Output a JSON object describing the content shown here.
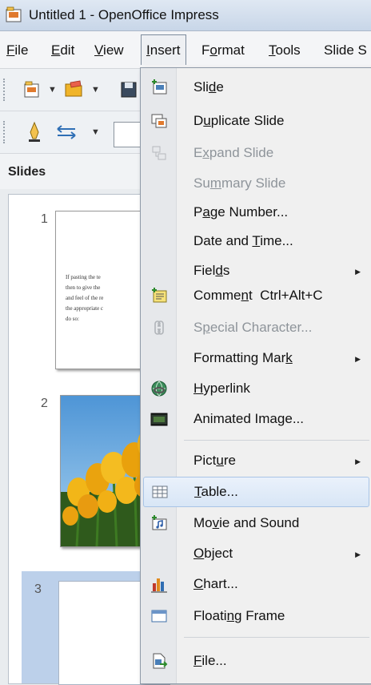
{
  "window": {
    "title": "Untitled 1 - OpenOffice Impress"
  },
  "menubar": {
    "items": [
      {
        "id": "file",
        "pre": "",
        "ul": "F",
        "post": "ile"
      },
      {
        "id": "edit",
        "pre": "",
        "ul": "E",
        "post": "dit"
      },
      {
        "id": "view",
        "pre": "",
        "ul": "V",
        "post": "iew"
      },
      {
        "id": "insert",
        "pre": "",
        "ul": "I",
        "post": "nsert"
      },
      {
        "id": "format",
        "pre": "F",
        "ul": "o",
        "post": "rmat"
      },
      {
        "id": "tools",
        "pre": "",
        "ul": "T",
        "post": "ools"
      },
      {
        "id": "slideshow",
        "pre": "Slide S",
        "ul": "",
        "post": ""
      }
    ]
  },
  "slides_pane": {
    "title": "Slides",
    "slides": [
      {
        "number": "1",
        "text": "If pasting the te\nthen to give the\nand feel of the re\nthe appropriate c\ndo so:"
      },
      {
        "number": "2"
      },
      {
        "number": "3"
      }
    ]
  },
  "insert_menu": {
    "items": [
      {
        "pre": "Sli",
        "ul": "d",
        "post": "e",
        "icon": "slide-icon",
        "enabled": true
      },
      {
        "pre": "D",
        "ul": "u",
        "post": "plicate Slide",
        "icon": "duplicate-slide-icon",
        "enabled": true
      },
      {
        "pre": "E",
        "ul": "x",
        "post": "pand Slide",
        "icon": "expand-slide-icon",
        "enabled": false
      },
      {
        "pre": "Su",
        "ul": "m",
        "post": "mary Slide",
        "icon": "",
        "enabled": false
      },
      {
        "pre": "P",
        "ul": "a",
        "post": "ge Number...",
        "icon": "",
        "enabled": true
      },
      {
        "pre": "Date and ",
        "ul": "T",
        "post": "ime...",
        "icon": "",
        "enabled": true
      },
      {
        "pre": "Fiel",
        "ul": "d",
        "post": "s",
        "icon": "",
        "enabled": true,
        "submenu": true
      },
      {
        "pre": "Comme",
        "ul": "n",
        "post": "t",
        "shortcut": "Ctrl+Alt+C",
        "icon": "comment-icon",
        "enabled": true
      },
      {
        "pre": "S",
        "ul": "p",
        "post": "ecial Character...",
        "icon": "special-character-icon",
        "enabled": false
      },
      {
        "pre": "Formatting Mar",
        "ul": "k",
        "post": "",
        "icon": "",
        "enabled": true,
        "submenu": true
      },
      {
        "pre": "",
        "ul": "H",
        "post": "yperlink",
        "icon": "hyperlink-icon",
        "enabled": true
      },
      {
        "pre": "Animated Ima",
        "ul": "g",
        "post": "e...",
        "icon": "animated-image-icon",
        "enabled": true
      },
      {
        "pre": "Pict",
        "ul": "u",
        "post": "re",
        "icon": "",
        "enabled": true,
        "submenu": true
      },
      {
        "pre": "",
        "ul": "T",
        "post": "able...",
        "icon": "table-icon",
        "enabled": true,
        "highlighted": true
      },
      {
        "pre": "Mo",
        "ul": "v",
        "post": "ie and Sound",
        "icon": "movie-sound-icon",
        "enabled": true
      },
      {
        "pre": "",
        "ul": "O",
        "post": "bject",
        "icon": "",
        "enabled": true,
        "submenu": true
      },
      {
        "pre": "",
        "ul": "C",
        "post": "hart...",
        "icon": "chart-icon",
        "enabled": true
      },
      {
        "pre": "Floati",
        "ul": "n",
        "post": "g Frame",
        "icon": "floating-frame-icon",
        "enabled": true
      },
      {
        "pre": "",
        "ul": "F",
        "post": "ile...",
        "icon": "file-icon",
        "enabled": true
      }
    ]
  }
}
